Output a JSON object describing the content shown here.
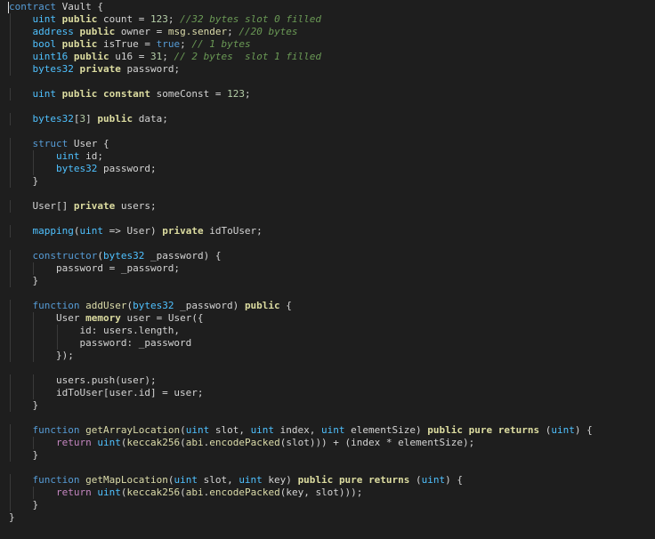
{
  "editor": {
    "lines": [
      [
        [
          "contract",
          "t-keyword"
        ],
        [
          " Vault {",
          "t-plain"
        ]
      ],
      [
        [
          "    ",
          "t-plain"
        ],
        [
          "uint",
          "t-type"
        ],
        [
          " ",
          "t-plain"
        ],
        [
          "public",
          "t-modifier"
        ],
        [
          " count = ",
          "t-plain"
        ],
        [
          "123",
          "t-number"
        ],
        [
          "; ",
          "t-plain"
        ],
        [
          "//32 bytes slot 0 filled",
          "t-comment"
        ]
      ],
      [
        [
          "    ",
          "t-plain"
        ],
        [
          "address",
          "t-type"
        ],
        [
          " ",
          "t-plain"
        ],
        [
          "public",
          "t-modifier"
        ],
        [
          " owner = ",
          "t-plain"
        ],
        [
          "msg.sender",
          "t-global"
        ],
        [
          "; ",
          "t-plain"
        ],
        [
          "//20 bytes",
          "t-comment"
        ]
      ],
      [
        [
          "    ",
          "t-plain"
        ],
        [
          "bool",
          "t-type"
        ],
        [
          " ",
          "t-plain"
        ],
        [
          "public",
          "t-modifier"
        ],
        [
          " isTrue = ",
          "t-plain"
        ],
        [
          "true",
          "t-bool"
        ],
        [
          "; ",
          "t-plain"
        ],
        [
          "// 1 bytes",
          "t-comment"
        ]
      ],
      [
        [
          "    ",
          "t-plain"
        ],
        [
          "uint16",
          "t-type"
        ],
        [
          " ",
          "t-plain"
        ],
        [
          "public",
          "t-modifier"
        ],
        [
          " u16 = ",
          "t-plain"
        ],
        [
          "31",
          "t-number"
        ],
        [
          "; ",
          "t-plain"
        ],
        [
          "// 2 bytes  slot 1 filled",
          "t-comment"
        ]
      ],
      [
        [
          "    ",
          "t-plain"
        ],
        [
          "bytes32",
          "t-type"
        ],
        [
          " ",
          "t-plain"
        ],
        [
          "private",
          "t-modifier"
        ],
        [
          " password;",
          "t-plain"
        ]
      ],
      [],
      [
        [
          "    ",
          "t-plain"
        ],
        [
          "uint",
          "t-type"
        ],
        [
          " ",
          "t-plain"
        ],
        [
          "public",
          "t-modifier"
        ],
        [
          " ",
          "t-plain"
        ],
        [
          "constant",
          "t-modifier"
        ],
        [
          " someConst = ",
          "t-plain"
        ],
        [
          "123",
          "t-number"
        ],
        [
          ";",
          "t-plain"
        ]
      ],
      [],
      [
        [
          "    ",
          "t-plain"
        ],
        [
          "bytes32",
          "t-type"
        ],
        [
          "[",
          "t-plain"
        ],
        [
          "3",
          "t-number"
        ],
        [
          "] ",
          "t-plain"
        ],
        [
          "public",
          "t-modifier"
        ],
        [
          " data;",
          "t-plain"
        ]
      ],
      [],
      [
        [
          "    ",
          "t-plain"
        ],
        [
          "struct",
          "t-keyword"
        ],
        [
          " User {",
          "t-plain"
        ]
      ],
      [
        [
          "        ",
          "t-plain"
        ],
        [
          "uint",
          "t-type"
        ],
        [
          " id;",
          "t-plain"
        ]
      ],
      [
        [
          "        ",
          "t-plain"
        ],
        [
          "bytes32",
          "t-type"
        ],
        [
          " password;",
          "t-plain"
        ]
      ],
      [
        [
          "    }",
          "t-plain"
        ]
      ],
      [],
      [
        [
          "    User[] ",
          "t-plain"
        ],
        [
          "private",
          "t-modifier"
        ],
        [
          " users;",
          "t-plain"
        ]
      ],
      [],
      [
        [
          "    ",
          "t-plain"
        ],
        [
          "mapping",
          "t-type"
        ],
        [
          "(",
          "t-plain"
        ],
        [
          "uint",
          "t-type"
        ],
        [
          " => User) ",
          "t-plain"
        ],
        [
          "private",
          "t-modifier"
        ],
        [
          " idToUser;",
          "t-plain"
        ]
      ],
      [],
      [
        [
          "    ",
          "t-plain"
        ],
        [
          "constructor",
          "t-keyword"
        ],
        [
          "(",
          "t-plain"
        ],
        [
          "bytes32",
          "t-type"
        ],
        [
          " _password) {",
          "t-plain"
        ]
      ],
      [
        [
          "        password = _password;",
          "t-plain"
        ]
      ],
      [
        [
          "    }",
          "t-plain"
        ]
      ],
      [],
      [
        [
          "    ",
          "t-plain"
        ],
        [
          "function",
          "t-keyword"
        ],
        [
          " ",
          "t-plain"
        ],
        [
          "addUser",
          "t-func"
        ],
        [
          "(",
          "t-plain"
        ],
        [
          "bytes32",
          "t-type"
        ],
        [
          " _password) ",
          "t-plain"
        ],
        [
          "public",
          "t-modifier"
        ],
        [
          " {",
          "t-plain"
        ]
      ],
      [
        [
          "        User ",
          "t-plain"
        ],
        [
          "memory",
          "t-modifier"
        ],
        [
          " user = User({",
          "t-plain"
        ]
      ],
      [
        [
          "            id: users.length,",
          "t-plain"
        ]
      ],
      [
        [
          "            password: _password",
          "t-plain"
        ]
      ],
      [
        [
          "        });",
          "t-plain"
        ]
      ],
      [],
      [
        [
          "        users.push(user);",
          "t-plain"
        ]
      ],
      [
        [
          "        idToUser[user.id] = user;",
          "t-plain"
        ]
      ],
      [
        [
          "    }",
          "t-plain"
        ]
      ],
      [],
      [
        [
          "    ",
          "t-plain"
        ],
        [
          "function",
          "t-keyword"
        ],
        [
          " ",
          "t-plain"
        ],
        [
          "getArrayLocation",
          "t-func"
        ],
        [
          "(",
          "t-plain"
        ],
        [
          "uint",
          "t-type"
        ],
        [
          " slot, ",
          "t-plain"
        ],
        [
          "uint",
          "t-type"
        ],
        [
          " index, ",
          "t-plain"
        ],
        [
          "uint",
          "t-type"
        ],
        [
          " elementSize) ",
          "t-plain"
        ],
        [
          "public",
          "t-modifier"
        ],
        [
          " ",
          "t-plain"
        ],
        [
          "pure",
          "t-modifier"
        ],
        [
          " ",
          "t-plain"
        ],
        [
          "returns",
          "t-modifier"
        ],
        [
          " (",
          "t-plain"
        ],
        [
          "uint",
          "t-type"
        ],
        [
          ") {",
          "t-plain"
        ]
      ],
      [
        [
          "        ",
          "t-plain"
        ],
        [
          "return",
          "t-ctrl"
        ],
        [
          " ",
          "t-plain"
        ],
        [
          "uint",
          "t-type"
        ],
        [
          "(",
          "t-plain"
        ],
        [
          "keccak256",
          "t-func"
        ],
        [
          "(",
          "t-plain"
        ],
        [
          "abi",
          "t-global"
        ],
        [
          ".",
          "t-plain"
        ],
        [
          "encodePacked",
          "t-func"
        ],
        [
          "(slot))) + (index * elementSize);",
          "t-plain"
        ]
      ],
      [
        [
          "    }",
          "t-plain"
        ]
      ],
      [],
      [
        [
          "    ",
          "t-plain"
        ],
        [
          "function",
          "t-keyword"
        ],
        [
          " ",
          "t-plain"
        ],
        [
          "getMapLocation",
          "t-func"
        ],
        [
          "(",
          "t-plain"
        ],
        [
          "uint",
          "t-type"
        ],
        [
          " slot, ",
          "t-plain"
        ],
        [
          "uint",
          "t-type"
        ],
        [
          " key) ",
          "t-plain"
        ],
        [
          "public",
          "t-modifier"
        ],
        [
          " ",
          "t-plain"
        ],
        [
          "pure",
          "t-modifier"
        ],
        [
          " ",
          "t-plain"
        ],
        [
          "returns",
          "t-modifier"
        ],
        [
          " (",
          "t-plain"
        ],
        [
          "uint",
          "t-type"
        ],
        [
          ") {",
          "t-plain"
        ]
      ],
      [
        [
          "        ",
          "t-plain"
        ],
        [
          "return",
          "t-ctrl"
        ],
        [
          " ",
          "t-plain"
        ],
        [
          "uint",
          "t-type"
        ],
        [
          "(",
          "t-plain"
        ],
        [
          "keccak256",
          "t-func"
        ],
        [
          "(",
          "t-plain"
        ],
        [
          "abi",
          "t-global"
        ],
        [
          ".",
          "t-plain"
        ],
        [
          "encodePacked",
          "t-func"
        ],
        [
          "(key, slot)));",
          "t-plain"
        ]
      ],
      [
        [
          "    }",
          "t-plain"
        ]
      ],
      [
        [
          "}",
          "t-plain"
        ]
      ]
    ]
  }
}
